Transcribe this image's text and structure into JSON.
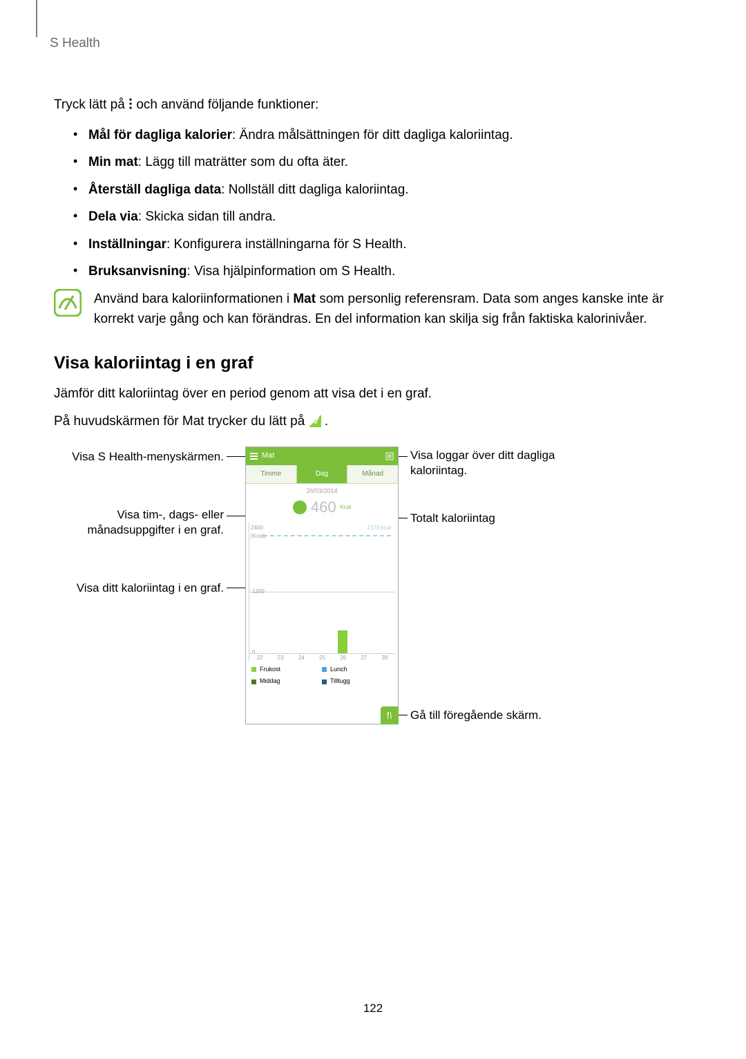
{
  "header": {
    "app": "S Health"
  },
  "intro": {
    "pre": "Tryck lätt på ",
    "post": " och använd följande funktioner:"
  },
  "funcs": [
    {
      "t": "Mål för dagliga kalorier",
      "d": ": Ändra målsättningen för ditt dagliga kaloriintag."
    },
    {
      "t": "Min mat",
      "d": ": Lägg till maträtter som du ofta äter."
    },
    {
      "t": "Återställ dagliga data",
      "d": ": Nollställ ditt dagliga kaloriintag."
    },
    {
      "t": "Dela via",
      "d": ": Skicka sidan till andra."
    },
    {
      "t": "Inställningar",
      "d": ": Konfigurera inställningarna för S Health."
    },
    {
      "t": "Bruksanvisning",
      "d": ": Visa hjälpinformation om S Health."
    }
  ],
  "note": {
    "p1": "Använd bara kaloriinformationen i ",
    "bold": "Mat",
    "p2": " som personlig referensram. Data som anges kanske inte är korrekt varje gång och kan förändras. En del information kan skilja sig från faktiska kalorinivåer."
  },
  "section": {
    "title": "Visa kaloriintag i en graf"
  },
  "body": {
    "p1": "Jämför ditt kaloriintag över en period genom att visa det i en graf.",
    "p2_pre": "På huvudskärmen för Mat trycker du lätt på ",
    "p2_post": "."
  },
  "callouts": {
    "menu": "Visa S Health-menyskärmen.",
    "period_l1": "Visa tim-, dags- eller",
    "period_l2": "månadsuppgifter i en graf.",
    "graph": "Visa ditt kaloriintag i en graf.",
    "log_l1": "Visa loggar över ditt dagliga",
    "log_l2": "kaloriintag.",
    "total": "Totalt kaloriintag",
    "back": "Gå till föregående skärm."
  },
  "phone": {
    "title": "Mat",
    "tabs": {
      "hour": "Timme",
      "day": "Dag",
      "month": "Månad"
    },
    "date": "26/03/2014",
    "big": "460",
    "kcal": "Kcal",
    "goal_label": "2170 kcal",
    "y_top": "2400",
    "y_top_sub": "(Kcal)",
    "y_mid": "1200",
    "y_zero": "0",
    "x": [
      "22",
      "23",
      "24",
      "25",
      "26",
      "27",
      "28"
    ],
    "legend": {
      "a": "Frukost",
      "b": "Lunch",
      "c": "Middag",
      "d": "Tilltugg"
    }
  },
  "chart_data": {
    "type": "bar",
    "title": "Dagligt kaloriintag",
    "xlabel": "Dag",
    "ylabel": "Kcal",
    "ylim": [
      0,
      2400
    ],
    "goal": 2170,
    "categories": [
      "22",
      "23",
      "24",
      "25",
      "26",
      "27",
      "28"
    ],
    "values": [
      0,
      0,
      0,
      0,
      460,
      0,
      0
    ]
  },
  "page_number": "122"
}
